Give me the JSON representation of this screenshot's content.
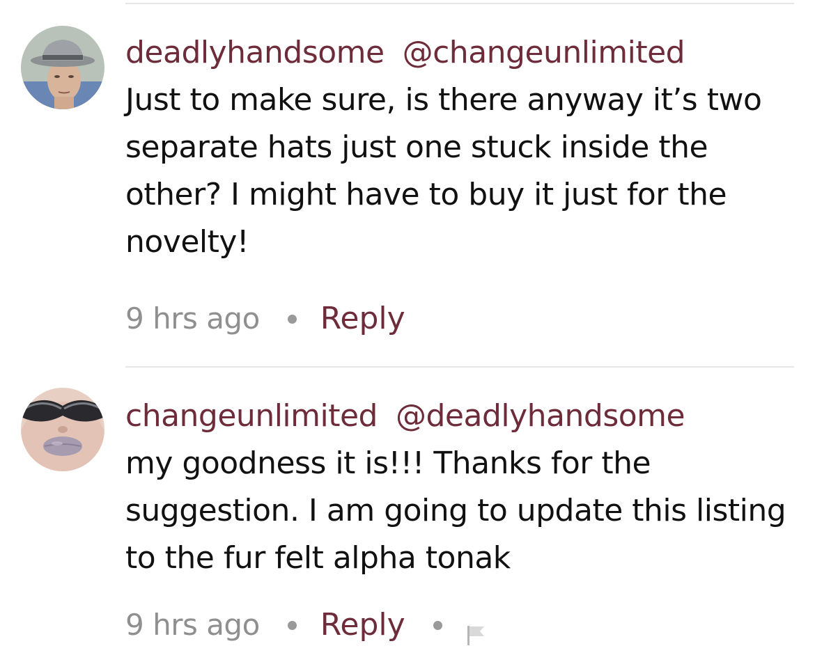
{
  "comments": [
    {
      "username": "deadlyhandsome",
      "mention": "@changeunlimited",
      "body": "Just to make sure, is there anyway it’s two separate hats just one stuck inside the other?  I might have to buy it just for the novelty!",
      "time": "9 hrs ago",
      "reply_label": "Reply",
      "avatar_icon": "avatar-man-fedora",
      "has_flag": false
    },
    {
      "username": "changeunlimited",
      "mention": "@deadlyhandsome",
      "body": "my goodness it is!!! Thanks for the suggestion.  I am going to update this listing to the fur felt alpha tonak",
      "time": "9 hrs ago",
      "reply_label": "Reply",
      "avatar_icon": "avatar-woman-sunglasses",
      "has_flag": true,
      "flag_icon": "flag-icon"
    }
  ],
  "colors": {
    "accent": "#6e2b3a",
    "muted": "#8f8f8f",
    "divider": "#e6e6e6"
  }
}
